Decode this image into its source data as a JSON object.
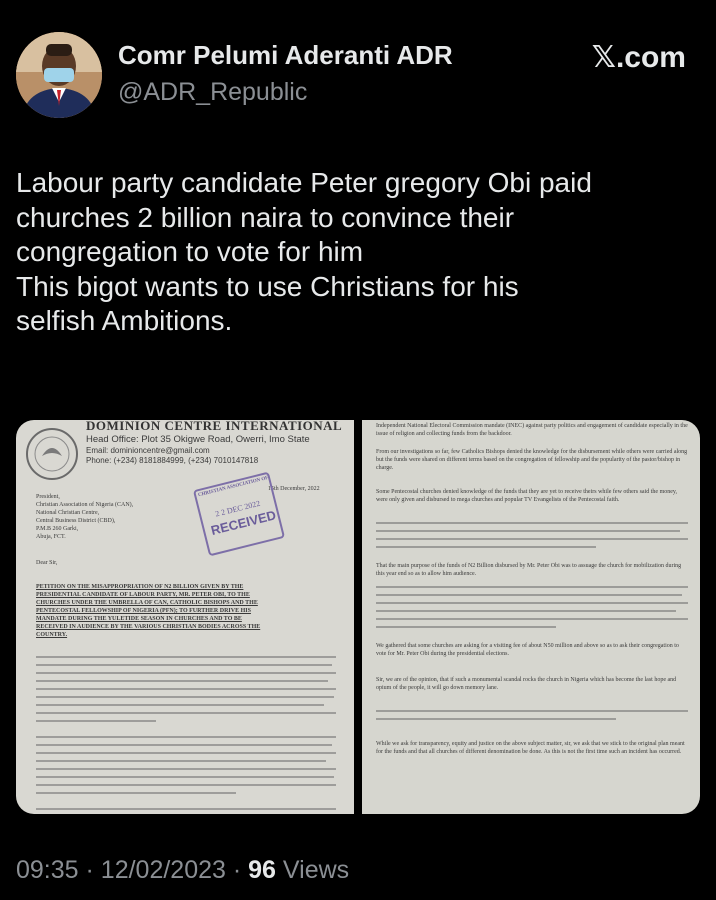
{
  "user": {
    "display_name": "Comr Pelumi Aderanti ADR",
    "handle": "@ADR_Republic"
  },
  "brand": "𝕏.com",
  "tweet": {
    "lines": [
      "Labour party candidate Peter gregory Obi paid",
      "churches 2 billion naira to convince their",
      "congregation to vote for him",
      "This bigot wants to use Christians for his",
      "selfish Ambitions."
    ]
  },
  "media": {
    "left": {
      "org": "DOMINION CENTRE INTERNATIONAL",
      "head_office": "Head Office: Plot 35 Okigwe Road, Owerri, Imo State",
      "email": "Email:  dominioncentre@gmail.com",
      "phone": "Phone:   (+234) 8181884999, (+234) 7010147818",
      "date": "15th December, 2022",
      "stamp_org": "CHRISTIAN ASSOCIATION OF NIGERIA",
      "stamp_date": "2 2 DEC 2022",
      "stamp_received": "RECEIVED",
      "address": [
        "President,",
        "Christian Association of Nigeria (CAN),",
        "National Christian Centre,",
        "Central Business District (CBD),",
        "P.M.B 260 Garki,",
        "Abuja, FCT."
      ],
      "salutation": "Dear Sir,",
      "subject": [
        "PETITION ON THE MISAPPROPRIATION OF N2 BILLION GIVEN BY THE",
        "PRESIDENTIAL CANDIDATE OF LABOUR PARTY, MR. PETER OBI, TO THE",
        "CHURCHES UNDER THE UMBRELLA OF CAN, CATHOLIC BISHOPS AND THE",
        "PENTECOSTAL FELLOWSHIP OF NIGERIA (PFN); TO FURTHER DRIVE HIS",
        "MANDATE DURING THE YULETIDE SEASON IN CHURCHES AND TO BE",
        "RECEIVED IN AUDIENCE BY THE VARIOUS CHRISTIAN BODIES ACROSS THE",
        "COUNTRY."
      ]
    },
    "right": {
      "paragraphs": [
        "Independent National Electoral Commission mandate (INEC) against party politics and engagement of candidate especially in the issue of religion and collecting funds from the backdoor.",
        "From our investigations so far, few Catholics Bishops denied the knowledge for the disbursement while others were carried along but the funds were shared on different terms based on the congregation of fellowship and the popularity of the pastor/bishop in charge.",
        "Some Pentecostal churches denied knowledge of the funds that they are yet to receive theirs while few others said the money, were only given and disbursed to mega churches and popular TV Evangelists of the Pentecostal faith.",
        "That the main purpose of the funds of N2 Billion disbursed by Mr. Peter Obi was to assuage the church for mobilization during this year end so as to allow him audience.",
        "We gathered that some churches are asking for a visiting fee of about N50 million and above so as to ask their congregation to vote for Mr. Peter Obi during the presidential elections.",
        "Sir, we are of the opinion, that if such a monumental scandal rocks the church in Nigeria which has become the last hope and opium of the people, it will go down memory lane.",
        "While we ask for transparency, equity and justice on the above subject matter, sir, we ask that we stick to the original plan meant for the funds and that all churches of different denomination be done. As this is not the first time such an incident has occurred."
      ]
    }
  },
  "footer": {
    "time": "09:35",
    "date": "12/02/2023",
    "views_count": "96",
    "views_label": "Views"
  }
}
